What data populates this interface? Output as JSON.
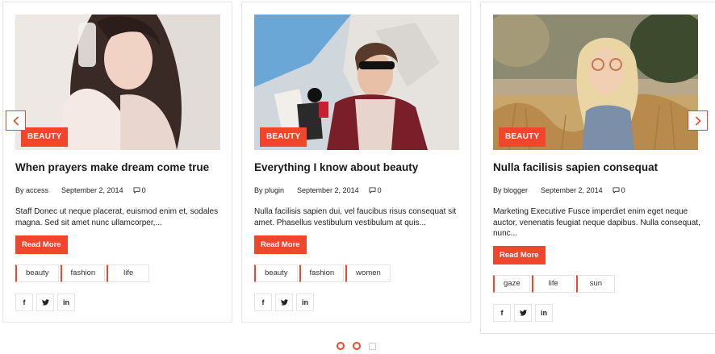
{
  "colors": {
    "accent": "#f0472c",
    "border": "#e6e6e6",
    "text": "#1a1a1a"
  },
  "carousel": {
    "prev_icon": "chevron-left-icon",
    "next_icon": "chevron-right-icon",
    "dots": [
      "active",
      "active",
      "inactive"
    ]
  },
  "posts": [
    {
      "category": "BEAUTY",
      "title": "When prayers make dream come true",
      "author": "By access",
      "date": "September 2, 2014",
      "comments": "0",
      "excerpt": "Staff Donec ut neque placerat, euismod enim et, sodales magna. Sed sit amet nunc ullamcorper,...",
      "read_more": "Read More",
      "tags": [
        "beauty",
        "fashion",
        "life"
      ],
      "share": [
        "f",
        "t",
        "in"
      ],
      "share_icons": [
        "facebook-icon",
        "twitter-icon",
        "linkedin-icon"
      ]
    },
    {
      "category": "BEAUTY",
      "title": "Everything I know about beauty",
      "author": "By plugin",
      "date": "September 2, 2014",
      "comments": "0",
      "excerpt": "Nulla facilisis sapien dui, vel faucibus risus consequat sit amet. Phasellus vestibulum vestibulum at quis...",
      "read_more": "Read More",
      "tags": [
        "beauty",
        "fashion",
        "women"
      ],
      "share": [
        "f",
        "t",
        "in"
      ],
      "share_icons": [
        "facebook-icon",
        "twitter-icon",
        "linkedin-icon"
      ]
    },
    {
      "category": "BEAUTY",
      "title": "Nulla facilisis sapien consequat",
      "author": "By blogger",
      "date": "September 2, 2014",
      "comments": "0",
      "excerpt": "Marketing Executive Fusce imperdiet enim eget neque auctor, venenatis feugiat neque dapibus. Nulla consequat, nunc...",
      "read_more": "Read More",
      "tags": [
        "gaze",
        "life",
        "sun"
      ],
      "share": [
        "f",
        "t",
        "in"
      ],
      "share_icons": [
        "facebook-icon",
        "twitter-icon",
        "linkedin-icon"
      ]
    }
  ]
}
